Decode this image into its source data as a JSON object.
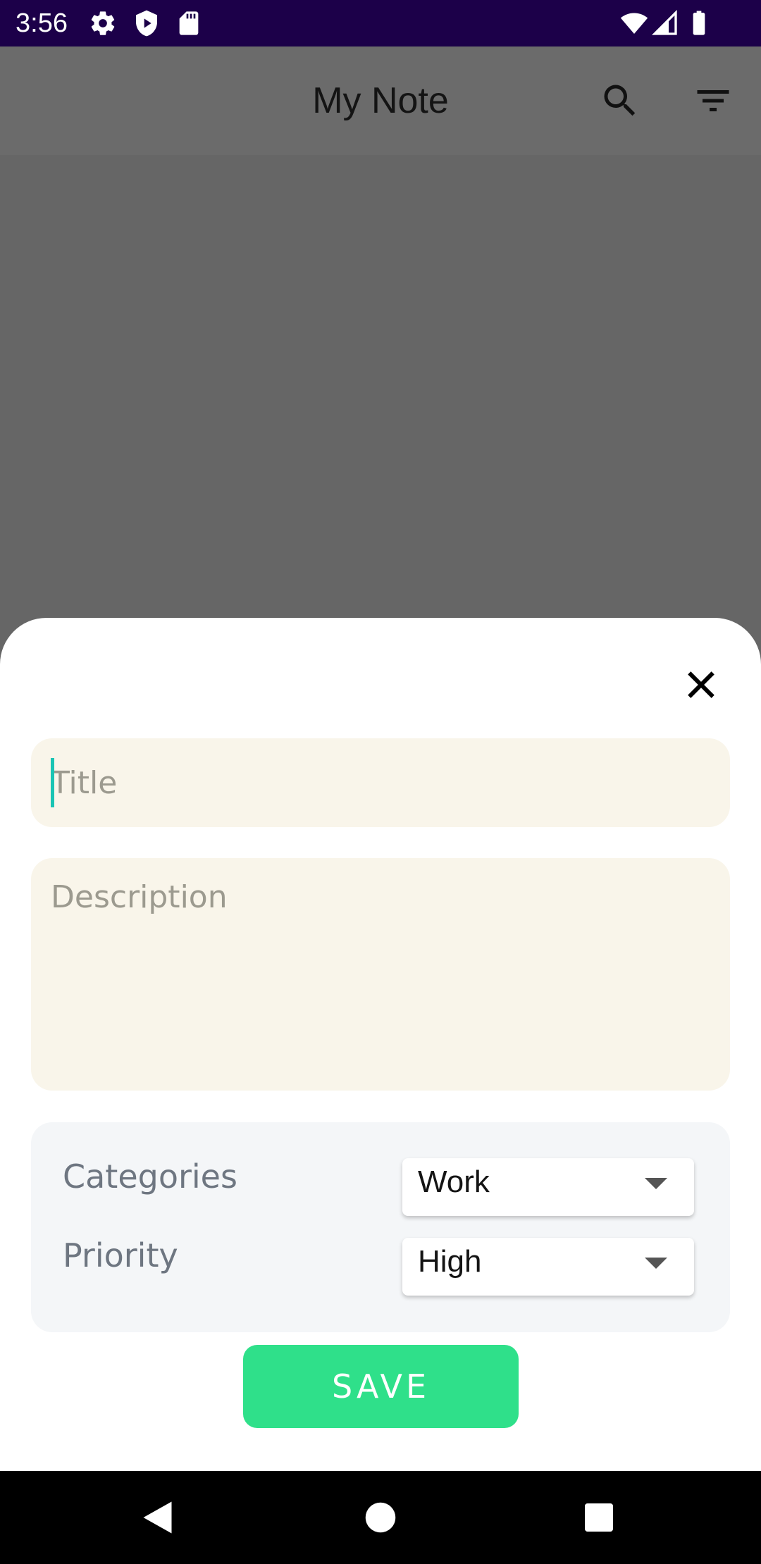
{
  "status_bar": {
    "time": "3:56",
    "icons": [
      "settings-icon",
      "shield-play-icon",
      "sd-card-icon",
      "wifi-icon",
      "signal-icon",
      "battery-icon"
    ],
    "background": "#1c0049"
  },
  "app_bar": {
    "title": "My Note",
    "icons": [
      "search-icon",
      "filter-icon"
    ]
  },
  "sheet": {
    "title_input": {
      "value": "",
      "placeholder": "Title"
    },
    "description_input": {
      "value": "",
      "placeholder": "Description"
    },
    "options": {
      "categories_label": "Categories",
      "categories_value": "Work",
      "priority_label": "Priority",
      "priority_value": "High"
    },
    "save_label": "SAVE",
    "save_color": "#2fe08a",
    "field_color": "#f9f5ea"
  },
  "nav_bar": {
    "icons": [
      "back-icon",
      "home-icon",
      "recents-icon"
    ]
  }
}
